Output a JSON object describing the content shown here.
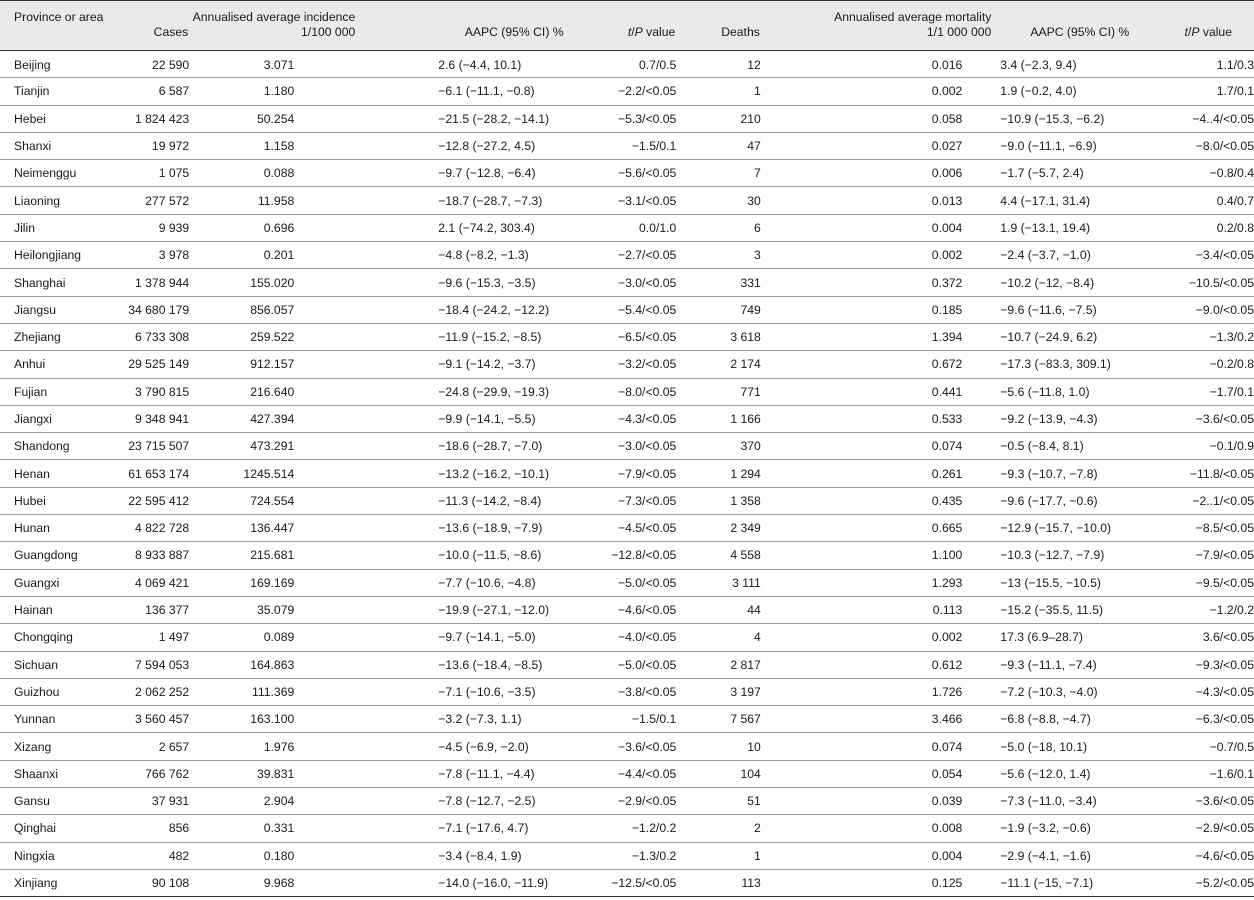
{
  "headers": {
    "province": "Province or area",
    "cases": "Cases",
    "incidence_line1": "Annualised average incidence",
    "incidence_line2": "1/100 000",
    "aapc1": "AAPC (95% CI) %",
    "tp1_t": "t",
    "tp1_rest": "/",
    "tp1_p": "P",
    "tp1_suffix": " value",
    "deaths": "Deaths",
    "mortality_line1": "Annualised average mortality",
    "mortality_line2": "1/1 000 000",
    "aapc2": "AAPC (95% CI) %",
    "tp2_t": "t",
    "tp2_rest": "/",
    "tp2_p": "P",
    "tp2_suffix": " value"
  },
  "rows": [
    {
      "province": "Beijing",
      "cases": "22 590",
      "incidence": "3.071",
      "aapc_inc": "2.6 (−4.4, 10.1)",
      "tp_inc": "0.7/0.5",
      "deaths": "12",
      "mortality": "0.016",
      "aapc_mort": "3.4 (−2.3, 9.4)",
      "tp_mort": "1.1/0.3"
    },
    {
      "province": "Tianjin",
      "cases": "6 587",
      "incidence": "1.180",
      "aapc_inc": "−6.1 (−11.1, −0.8)",
      "tp_inc": "−2.2/<0.05",
      "deaths": "1",
      "mortality": "0.002",
      "aapc_mort": "1.9 (−0.2, 4.0)",
      "tp_mort": "1.7/0.1"
    },
    {
      "province": "Hebei",
      "cases": "1 824 423",
      "incidence": "50.254",
      "aapc_inc": "−21.5 (−28.2, −14.1)",
      "tp_inc": "−5.3/<0.05",
      "deaths": "210",
      "mortality": "0.058",
      "aapc_mort": "−10.9 (−15.3, −6.2)",
      "tp_mort": "−4..4/<0.05"
    },
    {
      "province": "Shanxi",
      "cases": "19 972",
      "incidence": "1.158",
      "aapc_inc": "−12.8 (−27.2, 4.5)",
      "tp_inc": "−1.5/0.1",
      "deaths": "47",
      "mortality": "0.027",
      "aapc_mort": "−9.0 (−11.1, −6.9)",
      "tp_mort": "−8.0/<0.05"
    },
    {
      "province": "Neimenggu",
      "cases": "1 075",
      "incidence": "0.088",
      "aapc_inc": "−9.7 (−12.8, −6.4)",
      "tp_inc": "−5.6/<0.05",
      "deaths": "7",
      "mortality": "0.006",
      "aapc_mort": "−1.7 (−5.7, 2.4)",
      "tp_mort": "−0.8/0.4"
    },
    {
      "province": "Liaoning",
      "cases": "277 572",
      "incidence": "11.958",
      "aapc_inc": "−18.7 (−28.7, −7.3)",
      "tp_inc": "−3.1/<0.05",
      "deaths": "30",
      "mortality": "0.013",
      "aapc_mort": "4.4 (−17.1, 31.4)",
      "tp_mort": "0.4/0.7"
    },
    {
      "province": "Jilin",
      "cases": "9 939",
      "incidence": "0.696",
      "aapc_inc": "2.1 (−74.2, 303.4)",
      "tp_inc": "0.0/1.0",
      "deaths": "6",
      "mortality": "0.004",
      "aapc_mort": "1.9 (−13.1, 19.4)",
      "tp_mort": "0.2/0.8"
    },
    {
      "province": "Heilongjiang",
      "cases": "3 978",
      "incidence": "0.201",
      "aapc_inc": "−4.8 (−8.2, −1.3)",
      "tp_inc": "−2.7/<0.05",
      "deaths": "3",
      "mortality": "0.002",
      "aapc_mort": "−2.4 (−3.7, −1.0)",
      "tp_mort": "−3.4/<0.05"
    },
    {
      "province": "Shanghai",
      "cases": "1 378 944",
      "incidence": "155.020",
      "aapc_inc": "−9.6 (−15.3, −3.5)",
      "tp_inc": "−3.0/<0.05",
      "deaths": "331",
      "mortality": "0.372",
      "aapc_mort": "−10.2 (−12, −8.4)",
      "tp_mort": "−10.5/<0.05"
    },
    {
      "province": "Jiangsu",
      "cases": "34 680 179",
      "incidence": "856.057",
      "aapc_inc": "−18.4 (−24.2, −12.2)",
      "tp_inc": "−5.4/<0.05",
      "deaths": "749",
      "mortality": "0.185",
      "aapc_mort": "−9.6 (−11.6, −7.5)",
      "tp_mort": "−9.0/<0.05"
    },
    {
      "province": "Zhejiang",
      "cases": "6 733 308",
      "incidence": "259.522",
      "aapc_inc": "−11.9 (−15.2, −8.5)",
      "tp_inc": "−6.5/<0.05",
      "deaths": "3 618",
      "mortality": "1.394",
      "aapc_mort": "−10.7 (−24.9, 6.2)",
      "tp_mort": "−1.3/0.2"
    },
    {
      "province": "Anhui",
      "cases": "29 525 149",
      "incidence": "912.157",
      "aapc_inc": "−9.1 (−14.2, −3.7)",
      "tp_inc": "−3.2/<0.05",
      "deaths": "2 174",
      "mortality": "0.672",
      "aapc_mort": "−17.3 (−83.3, 309.1)",
      "tp_mort": "−0.2/0.8"
    },
    {
      "province": "Fujian",
      "cases": "3 790 815",
      "incidence": "216.640",
      "aapc_inc": "−24.8 (−29.9, −19.3)",
      "tp_inc": "−8.0/<0.05",
      "deaths": "771",
      "mortality": "0.441",
      "aapc_mort": "−5.6 (−11.8, 1.0)",
      "tp_mort": "−1.7/0.1"
    },
    {
      "province": "Jiangxi",
      "cases": "9 348 941",
      "incidence": "427.394",
      "aapc_inc": "−9.9 (−14.1, −5.5)",
      "tp_inc": "−4.3/<0.05",
      "deaths": "1 166",
      "mortality": "0.533",
      "aapc_mort": "−9.2 (−13.9, −4.3)",
      "tp_mort": "−3.6/<0.05"
    },
    {
      "province": "Shandong",
      "cases": "23 715 507",
      "incidence": "473.291",
      "aapc_inc": "−18.6 (−28.7, −7.0)",
      "tp_inc": "−3.0/<0.05",
      "deaths": "370",
      "mortality": "0.074",
      "aapc_mort": "−0.5 (−8.4, 8.1)",
      "tp_mort": "−0.1/0.9"
    },
    {
      "province": "Henan",
      "cases": "61 653 174",
      "incidence": "1245.514",
      "aapc_inc": "−13.2 (−16.2, −10.1)",
      "tp_inc": "−7.9/<0.05",
      "deaths": "1 294",
      "mortality": "0.261",
      "aapc_mort": "−9.3 (−10.7, −7.8)",
      "tp_mort": "−11.8/<0.05"
    },
    {
      "province": "Hubei",
      "cases": "22 595 412",
      "incidence": "724.554",
      "aapc_inc": "−11.3 (−14.2, −8.4)",
      "tp_inc": "−7.3/<0.05",
      "deaths": "1 358",
      "mortality": "0.435",
      "aapc_mort": "−9.6 (−17.7, −0.6)",
      "tp_mort": "−2..1/<0.05"
    },
    {
      "province": "Hunan",
      "cases": "4 822 728",
      "incidence": "136.447",
      "aapc_inc": "−13.6 (−18.9, −7.9)",
      "tp_inc": "−4.5/<0.05",
      "deaths": "2 349",
      "mortality": "0.665",
      "aapc_mort": "−12.9 (−15.7, −10.0)",
      "tp_mort": "−8.5/<0.05"
    },
    {
      "province": "Guangdong",
      "cases": "8 933 887",
      "incidence": "215.681",
      "aapc_inc": "−10.0 (−11.5, −8.6)",
      "tp_inc": "−12.8/<0.05",
      "deaths": "4 558",
      "mortality": "1.100",
      "aapc_mort": "−10.3 (−12.7, −7.9)",
      "tp_mort": "−7.9/<0.05"
    },
    {
      "province": "Guangxi",
      "cases": "4 069 421",
      "incidence": "169.169",
      "aapc_inc": "−7.7 (−10.6, −4.8)",
      "tp_inc": "−5.0/<0.05",
      "deaths": "3 111",
      "mortality": "1.293",
      "aapc_mort": "−13 (−15.5, −10.5)",
      "tp_mort": "−9.5/<0.05"
    },
    {
      "province": "Hainan",
      "cases": "136 377",
      "incidence": "35.079",
      "aapc_inc": "−19.9 (−27.1, −12.0)",
      "tp_inc": "−4.6/<0.05",
      "deaths": "44",
      "mortality": "0.113",
      "aapc_mort": "−15.2 (−35.5, 11.5)",
      "tp_mort": "−1.2/0.2"
    },
    {
      "province": "Chongqing",
      "cases": "1 497",
      "incidence": "0.089",
      "aapc_inc": "−9.7 (−14.1, −5.0)",
      "tp_inc": "−4.0/<0.05",
      "deaths": "4",
      "mortality": "0.002",
      "aapc_mort": "17.3 (6.9–28.7)",
      "tp_mort": "3.6/<0.05"
    },
    {
      "province": "Sichuan",
      "cases": "7 594 053",
      "incidence": "164.863",
      "aapc_inc": "−13.6 (−18.4, −8.5)",
      "tp_inc": "−5.0/<0.05",
      "deaths": "2 817",
      "mortality": "0.612",
      "aapc_mort": "−9.3 (−11.1, −7.4)",
      "tp_mort": "−9.3/<0.05"
    },
    {
      "province": "Guizhou",
      "cases": "2 062 252",
      "incidence": "111.369",
      "aapc_inc": "−7.1 (−10.6, −3.5)",
      "tp_inc": "−3.8/<0.05",
      "deaths": "3 197",
      "mortality": "1.726",
      "aapc_mort": "−7.2 (−10.3, −4.0)",
      "tp_mort": "−4.3/<0.05"
    },
    {
      "province": "Yunnan",
      "cases": "3 560 457",
      "incidence": "163.100",
      "aapc_inc": "−3.2 (−7.3, 1.1)",
      "tp_inc": "−1.5/0.1",
      "deaths": "7 567",
      "mortality": "3.466",
      "aapc_mort": "−6.8 (−8.8, −4.7)",
      "tp_mort": "−6.3/<0.05"
    },
    {
      "province": "Xizang",
      "cases": "2 657",
      "incidence": "1.976",
      "aapc_inc": "−4.5 (−6.9, −2.0)",
      "tp_inc": "−3.6/<0.05",
      "deaths": "10",
      "mortality": "0.074",
      "aapc_mort": "−5.0 (−18, 10.1)",
      "tp_mort": "−0.7/0.5"
    },
    {
      "province": "Shaanxi",
      "cases": "766 762",
      "incidence": "39.831",
      "aapc_inc": "−7.8 (−11.1, −4.4)",
      "tp_inc": "−4.4/<0.05",
      "deaths": "104",
      "mortality": "0.054",
      "aapc_mort": "−5.6 (−12.0, 1.4)",
      "tp_mort": "−1.6/0.1"
    },
    {
      "province": "Gansu",
      "cases": "37 931",
      "incidence": "2.904",
      "aapc_inc": "−7.8 (−12.7, −2.5)",
      "tp_inc": "−2.9/<0.05",
      "deaths": "51",
      "mortality": "0.039",
      "aapc_mort": "−7.3 (−11.0, −3.4)",
      "tp_mort": "−3.6/<0.05"
    },
    {
      "province": "Qinghai",
      "cases": "856",
      "incidence": "0.331",
      "aapc_inc": "−7.1 (−17.6, 4.7)",
      "tp_inc": "−1.2/0.2",
      "deaths": "2",
      "mortality": "0.008",
      "aapc_mort": "−1.9 (−3.2, −0.6)",
      "tp_mort": "−2.9/<0.05"
    },
    {
      "province": "Ningxia",
      "cases": "482",
      "incidence": "0.180",
      "aapc_inc": "−3.4 (−8.4, 1.9)",
      "tp_inc": "−1.3/0.2",
      "deaths": "1",
      "mortality": "0.004",
      "aapc_mort": "−2.9 (−4.1, −1.6)",
      "tp_mort": "−4.6/<0.05"
    },
    {
      "province": "Xinjiang",
      "cases": "90 108",
      "incidence": "9.968",
      "aapc_inc": "−14.0 (−16.0, −11.9)",
      "tp_inc": "−12.5/<0.05",
      "deaths": "113",
      "mortality": "0.125",
      "aapc_mort": "−11.1 (−15, −7.1)",
      "tp_mort": "−5.2/<0.05"
    }
  ]
}
